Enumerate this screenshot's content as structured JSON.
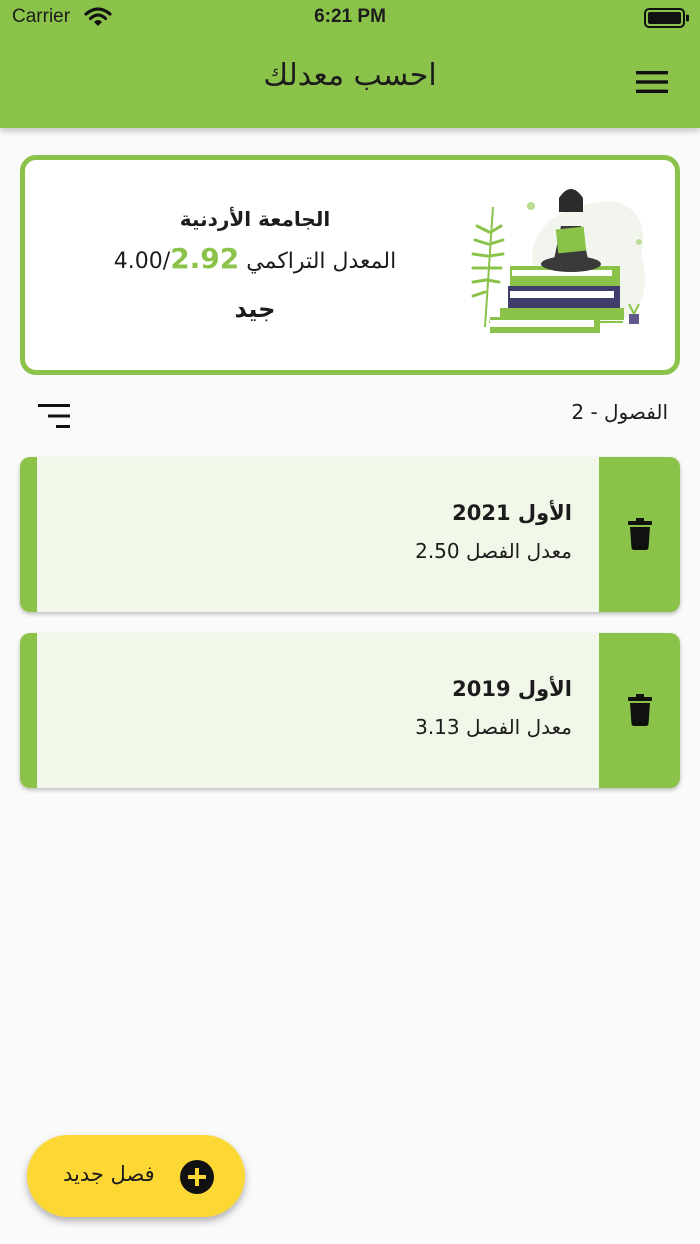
{
  "status_bar": {
    "carrier": "Carrier",
    "time": "6:21 PM"
  },
  "app_bar": {
    "title": "احسب معدلك"
  },
  "summary": {
    "university": "الجامعة الأردنية",
    "gpa_label": "المعدل التراكمي",
    "gpa_max": "4.00/",
    "gpa_value": "2.92",
    "grade": "جيد"
  },
  "semesters_header": {
    "count_label": "الفصول - 2"
  },
  "semesters": [
    {
      "title": "الأول 2021",
      "gpa_text": "معدل الفصل 2.50"
    },
    {
      "title": "الأول 2019",
      "gpa_text": "معدل الفصل 3.13"
    }
  ],
  "fab": {
    "label": "فصل جديد"
  },
  "colors": {
    "primary": "#8bc34a",
    "card_bg": "#f1f8e9",
    "fab": "#fdd835"
  }
}
